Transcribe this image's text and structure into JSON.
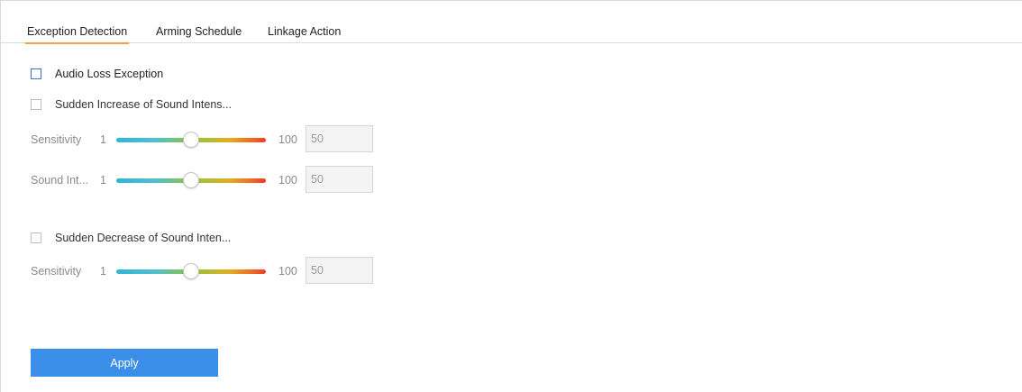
{
  "tabs": [
    {
      "label": "Exception Detection",
      "active": true
    },
    {
      "label": "Arming Schedule",
      "active": false
    },
    {
      "label": "Linkage Action",
      "active": false
    }
  ],
  "audio_loss": {
    "label": "Audio Loss Exception",
    "checked": false
  },
  "sudden_increase": {
    "label": "Sudden Increase of Sound Intens...",
    "checked": false,
    "sensitivity": {
      "label": "Sensitivity",
      "min": "1",
      "max": "100",
      "value": "50"
    },
    "sound_intensity": {
      "label": "Sound Int...",
      "min": "1",
      "max": "100",
      "value": "50"
    }
  },
  "sudden_decrease": {
    "label": "Sudden Decrease of Sound Inten...",
    "checked": false,
    "sensitivity": {
      "label": "Sensitivity",
      "min": "1",
      "max": "100",
      "value": "50"
    }
  },
  "apply_label": "Apply",
  "colors": {
    "accent": "#3b8fe8",
    "tab_underline": "#f0a050",
    "checkbox_blue": "#3d72c9"
  },
  "slider_level": 0.5
}
